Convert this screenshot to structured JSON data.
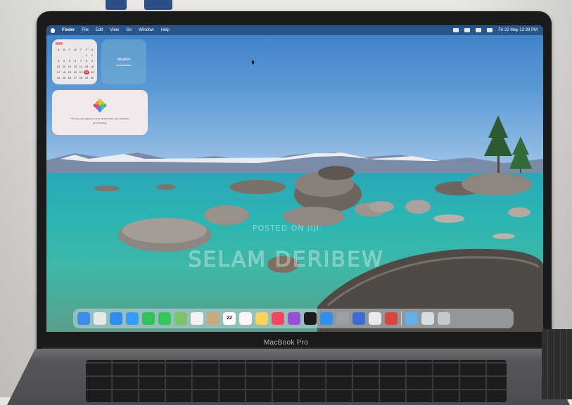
{
  "device_label": "MacBook Pro",
  "menubar": {
    "app_name": "Finder",
    "menus": [
      "File",
      "Edit",
      "View",
      "Go",
      "Window",
      "Help"
    ],
    "clock": "Fri 22 May  12:38 PM"
  },
  "widgets": {
    "calendar": {
      "month": "MAY",
      "weekdays": [
        "S",
        "M",
        "T",
        "W",
        "T",
        "F",
        "S"
      ],
      "days": [
        "",
        "",
        "",
        "",
        "",
        "1",
        "2",
        "3",
        "4",
        "5",
        "6",
        "7",
        "8",
        "9",
        "10",
        "11",
        "12",
        "13",
        "14",
        "15",
        "16",
        "17",
        "18",
        "19",
        "20",
        "21",
        "22",
        "23",
        "24",
        "25",
        "26",
        "27",
        "28",
        "29",
        "30"
      ],
      "today": "22"
    },
    "weather": {
      "title": "Weather",
      "subtitle": "Unavailable"
    },
    "photos": {
      "text": "Photos will appear here when they are finished processing."
    }
  },
  "dock": {
    "calendar_date": "22",
    "apps": [
      {
        "icon": "finder-icon",
        "color": "#3b8fe8"
      },
      {
        "icon": "launchpad-icon",
        "color": "#e8e8ea"
      },
      {
        "icon": "safari-icon",
        "color": "#2f8cf0"
      },
      {
        "icon": "mail-icon",
        "color": "#3a9bf5"
      },
      {
        "icon": "facetime-icon",
        "color": "#33c25a"
      },
      {
        "icon": "messages-icon",
        "color": "#35c759"
      },
      {
        "icon": "maps-icon",
        "color": "#7bc26a"
      },
      {
        "icon": "photos-icon",
        "color": "#f5f0ef"
      },
      {
        "icon": "contacts-icon",
        "color": "#c9a97e"
      },
      {
        "icon": "calendar-icon",
        "color": "#ffffff"
      },
      {
        "icon": "reminders-icon",
        "color": "#f7f7f7"
      },
      {
        "icon": "notes-icon",
        "color": "#f7d55a"
      },
      {
        "icon": "music-icon",
        "color": "#f2485f"
      },
      {
        "icon": "podcasts-icon",
        "color": "#9b4fd8"
      },
      {
        "icon": "tv-icon",
        "color": "#1c1c1e"
      },
      {
        "icon": "app-store-icon",
        "color": "#2d8ff2"
      },
      {
        "icon": "system-settings-icon",
        "color": "#9aa0a6"
      },
      {
        "icon": "preview-icon",
        "color": "#3f6bd6"
      },
      {
        "icon": "keychain-icon",
        "color": "#e9e9e9"
      },
      {
        "icon": "photo-booth-icon",
        "color": "#d8453f"
      },
      {
        "icon": "folder-icon",
        "color": "#62b0ea"
      },
      {
        "icon": "downloads-icon",
        "color": "#d9dde0"
      },
      {
        "icon": "trash-icon",
        "color": "#c6c9cc"
      }
    ]
  },
  "watermark": {
    "line1": "POSTED ON JIJI",
    "line2": "SELAM DERIBEW"
  },
  "colors": {
    "lid": "#1a1b1d",
    "sky_top": "#3d7fc7",
    "water": "#2db5b2",
    "dock": "#c8d7dc"
  }
}
